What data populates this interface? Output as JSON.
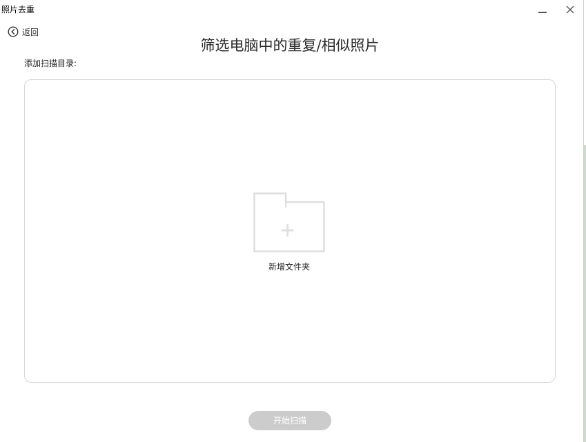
{
  "window": {
    "title": "照片去重",
    "minimize_icon": "minimize-icon",
    "close_icon": "close-icon"
  },
  "nav": {
    "back_label": "返回",
    "back_icon": "circle-chevron-left-icon"
  },
  "main": {
    "title": "筛选电脑中的重复/相似照片",
    "scan_dir_label": "添加扫描目录:",
    "add_folder_label": "新增文件夹",
    "add_folder_icon": "folder-plus-icon",
    "start_button_label": "开始扫描",
    "start_button_state": "disabled"
  },
  "colors": {
    "background": "#ffffff",
    "border": "#d6d6d6",
    "icon_gray": "#dedede",
    "disabled_button": "#cccccc",
    "text": "#222222"
  }
}
